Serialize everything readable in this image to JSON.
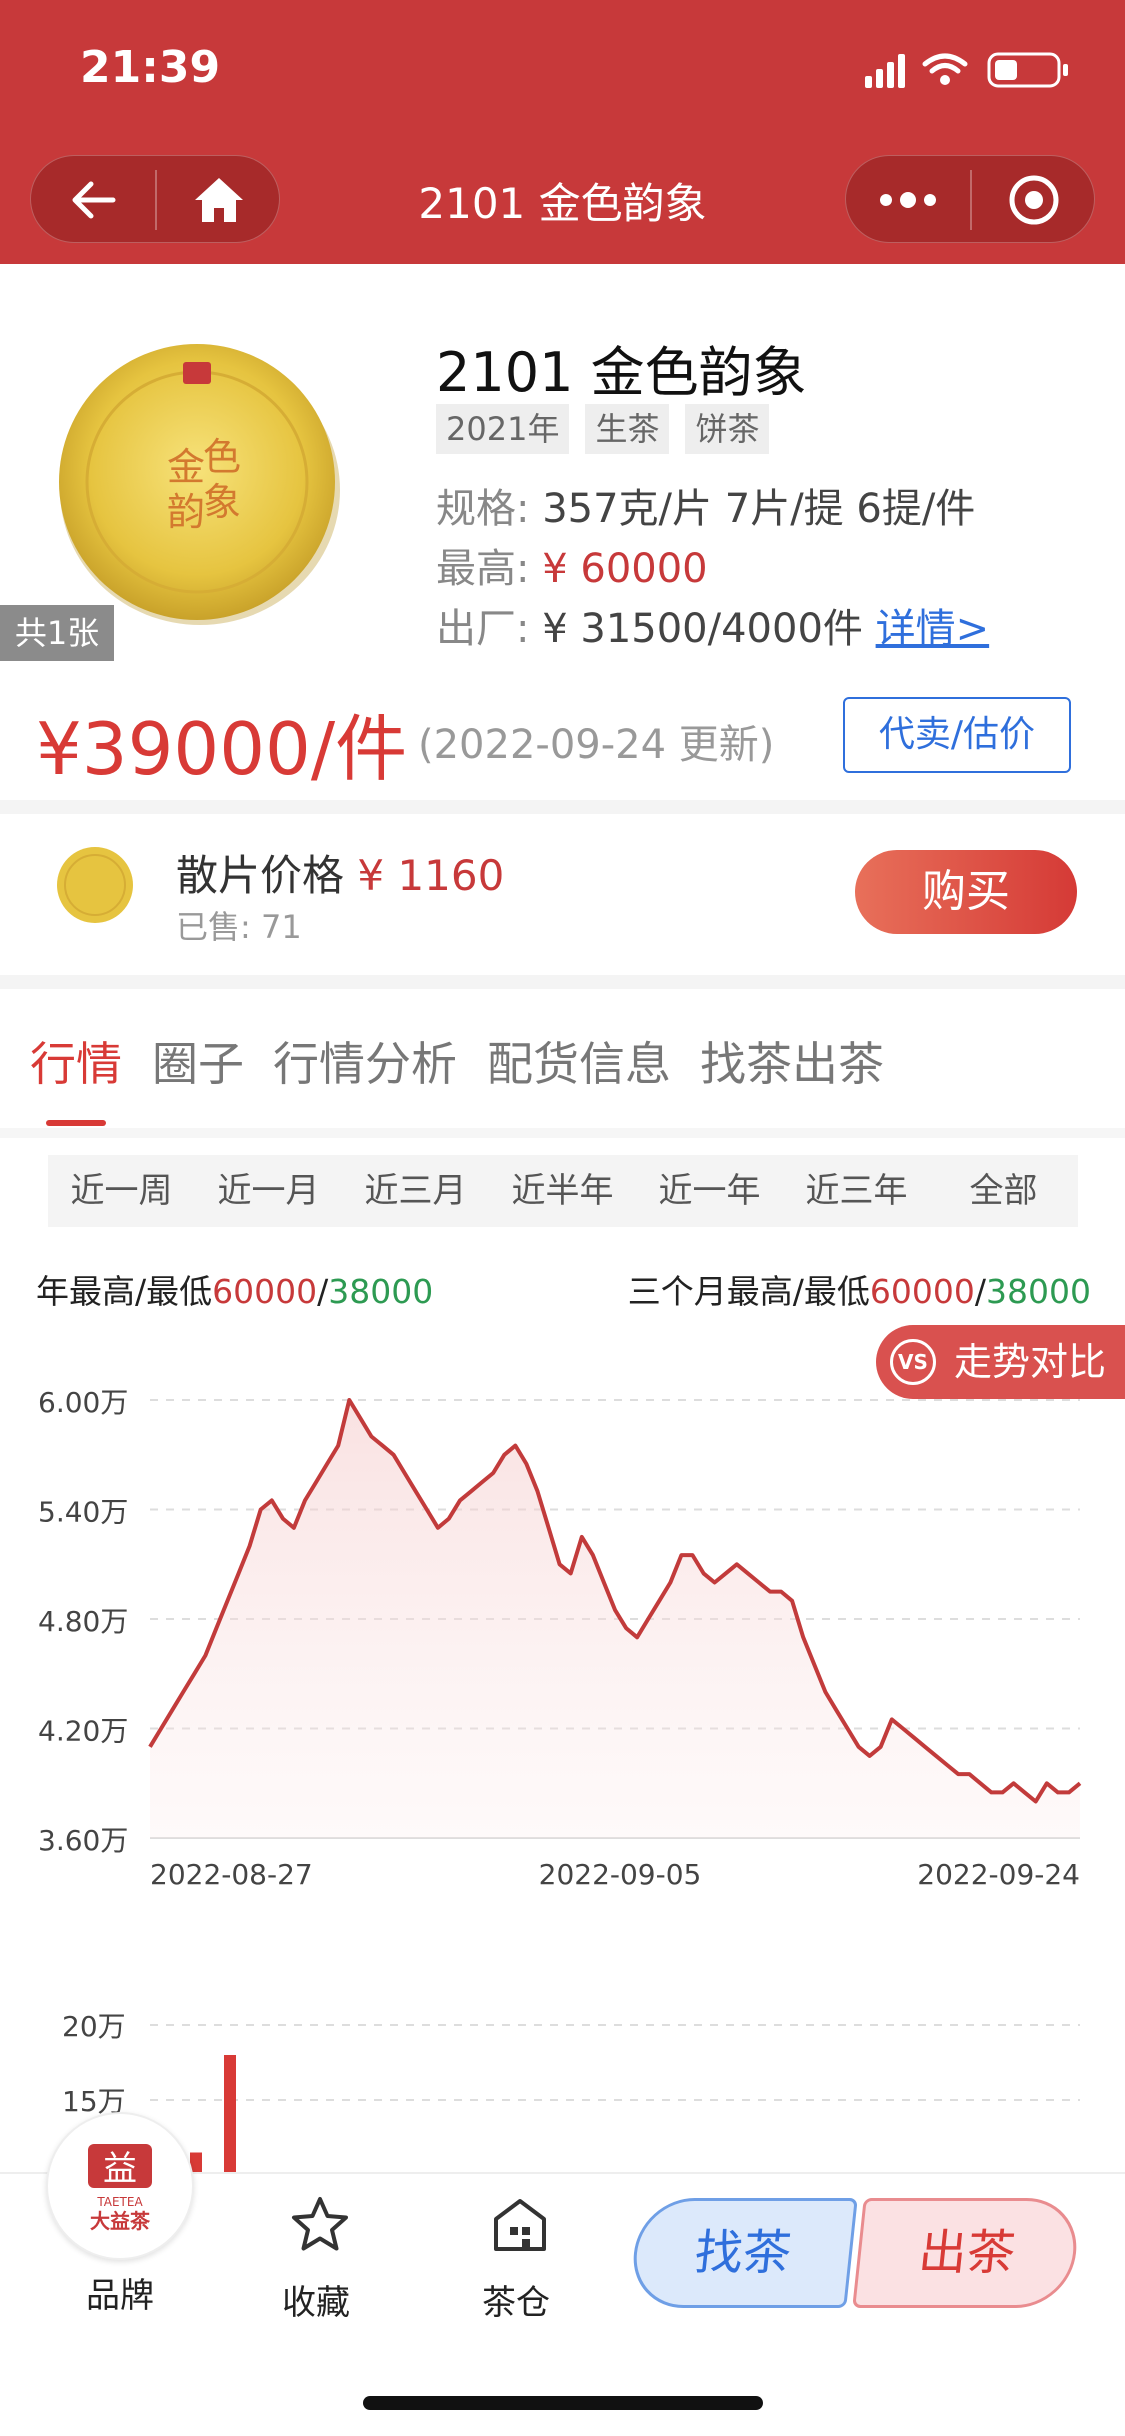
{
  "status_bar": {
    "time": "21:39"
  },
  "nav": {
    "title": "2101 金色韵象"
  },
  "product": {
    "image_count": "共1张",
    "title": "2101 金色韵象",
    "tags": [
      "2021年",
      "生茶",
      "饼茶"
    ],
    "spec_label": "规格:",
    "spec_value": "357克/片 7片/提 6提/件",
    "max_label": "最高:",
    "max_value": "¥ 60000",
    "factory_label": "出厂:",
    "factory_value": "¥ 31500/4000件",
    "details_link": "详情>",
    "price": "¥39000/件",
    "update_note": "(2022-09-24 更新)",
    "sell_button": "代卖/估价"
  },
  "loose": {
    "label": "散片价格",
    "price": "¥ 1160",
    "sold": "已售: 71",
    "buy_button": "购买"
  },
  "tabs": [
    "行情",
    "圈子",
    "行情分析",
    "配货信息",
    "找茶出茶"
  ],
  "ranges": [
    "近一周",
    "近一月",
    "近三月",
    "近半年",
    "近一年",
    "近三年",
    "全部"
  ],
  "active_range_index": 2,
  "summary": {
    "year_label": "年最高/最低",
    "year_high": "60000",
    "slash": "/",
    "year_low": "38000",
    "three_month_label": "三个月最高/最低",
    "three_month_high": "60000",
    "three_month_low": "38000"
  },
  "compare_button": "走势对比",
  "compare_icon_text": "VS",
  "colors": {
    "header": "#c7393a",
    "price_red": "#d83a36",
    "link_blue": "#2f6fdc",
    "low_green": "#2d9a52",
    "line": "#c23b3b"
  },
  "chart_data": [
    {
      "type": "area",
      "title": "",
      "y_tick_labels": [
        "6.00万",
        "5.40万",
        "4.80万",
        "4.20万",
        "3.60万"
      ],
      "y_ticks": [
        60000,
        54000,
        48000,
        42000,
        36000
      ],
      "ylim": [
        36000,
        60000
      ],
      "x_tick_labels": [
        "2022-08-27",
        "2022-09-05",
        "2022-09-24"
      ],
      "grid": true,
      "series": [
        {
          "values": [
            41000,
            42000,
            43000,
            44000,
            45000,
            46000,
            47500,
            49000,
            50500,
            52000,
            54000,
            54500,
            53500,
            53000,
            54500,
            55500,
            56500,
            57500,
            60000,
            59000,
            58000,
            57500,
            57000,
            56000,
            55000,
            54000,
            53000,
            53500,
            54500,
            55000,
            55500,
            56000,
            57000,
            57500,
            56500,
            55000,
            53000,
            51000,
            50500,
            52500,
            51500,
            50000,
            48500,
            47500,
            47000,
            48000,
            49000,
            50000,
            51500,
            51500,
            50500,
            50000,
            50500,
            51000,
            50500,
            50000,
            49500,
            49500,
            49000,
            47000,
            45500,
            44000,
            43000,
            42000,
            41000,
            40500,
            41000,
            42500,
            42000,
            41500,
            41000,
            40500,
            40000,
            39500,
            39500,
            39000,
            38500,
            38500,
            39000,
            38500,
            38000,
            39000,
            38500,
            38500,
            39000
          ]
        }
      ]
    },
    {
      "type": "bar",
      "title": "",
      "y_tick_labels": [
        "20万",
        "15万"
      ],
      "y_ticks": [
        200000,
        150000
      ],
      "ylim": [
        100000,
        200000
      ],
      "series": [
        {
          "values": [
            115000,
            180000
          ]
        }
      ]
    }
  ],
  "bottom_bar": {
    "brand_logo_text": "益",
    "brand_logo_sub1": "TAETEA",
    "brand_logo_sub2": "大益茶",
    "brand_label": "品牌",
    "favorite_label": "收藏",
    "warehouse_label": "茶仓",
    "find_button": "找茶",
    "sell_button": "出茶"
  }
}
